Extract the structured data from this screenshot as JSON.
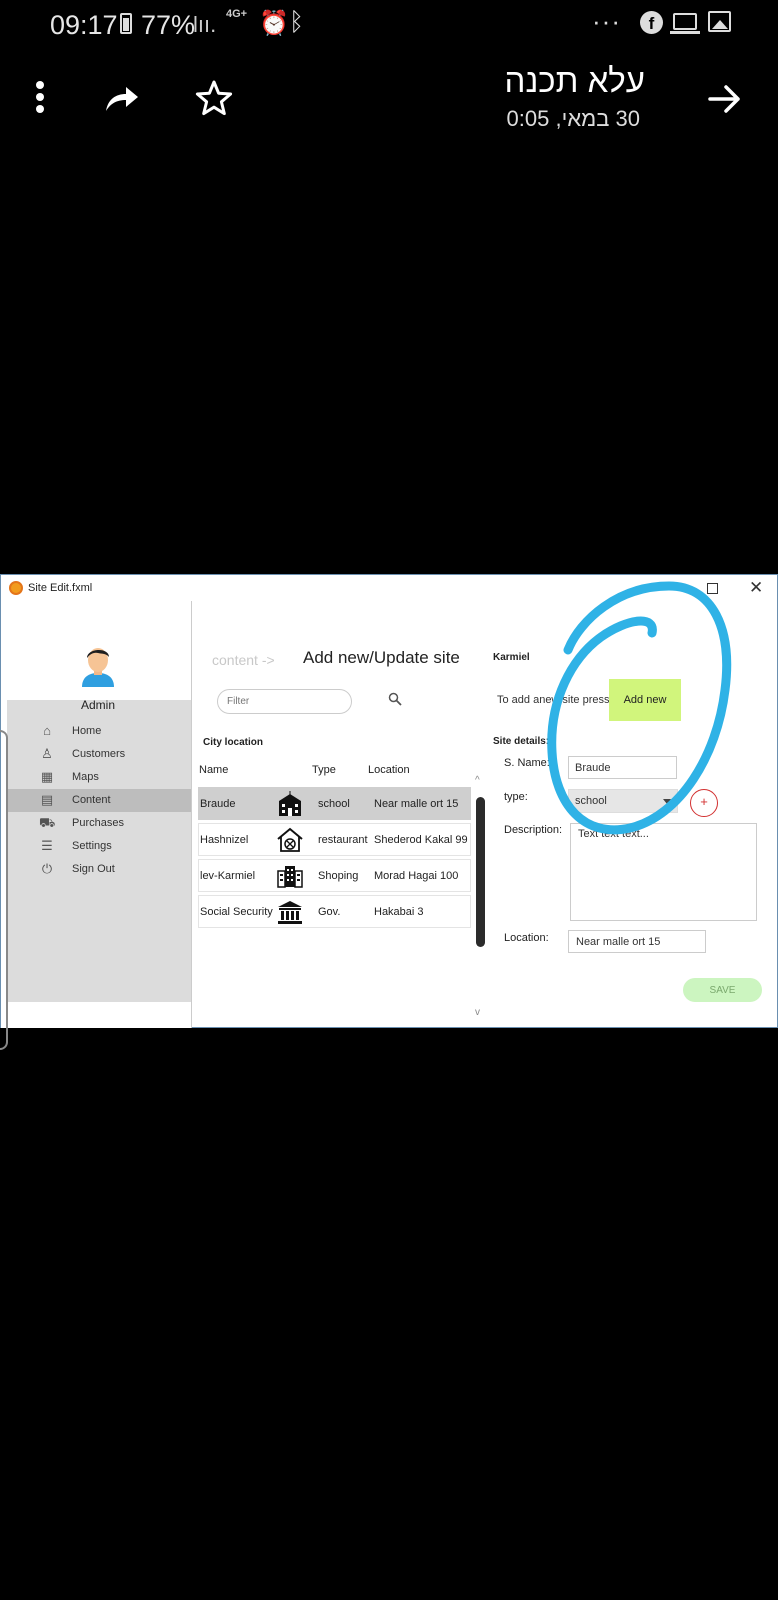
{
  "status_bar": {
    "time": "09:17",
    "battery": "77%",
    "signal": "lıı.",
    "network": "4G+",
    "overflow_dots": "···",
    "facebook_letter": "f"
  },
  "app_bar": {
    "title": "עלא תכנה",
    "subtitle": "30 במאי, 0:05"
  },
  "window": {
    "title": "Site Edit.fxml",
    "max_symbol": "",
    "close_symbol": "✕"
  },
  "sidebar": {
    "user": "Admin",
    "items": [
      {
        "label": "Home",
        "icon": "⌂"
      },
      {
        "label": "Customers",
        "icon": "♙"
      },
      {
        "label": "Maps",
        "icon": "▦"
      },
      {
        "label": "Content",
        "icon": "▤"
      },
      {
        "label": "Purchases",
        "icon": "⛟"
      },
      {
        "label": "Settings",
        "icon": "☰"
      },
      {
        "label": "Sign Out",
        "icon": "⏻"
      }
    ],
    "active_item": "Content"
  },
  "main": {
    "breadcrumb": "content ->",
    "title": "Add new/Update site",
    "filter_placeholder": "Filter",
    "city_location": "City location",
    "columns": [
      "Name",
      "Type",
      "Location"
    ],
    "rows": [
      {
        "name": "Braude",
        "type": "school",
        "location": "Near malle ort 15",
        "icon": "school-icon"
      },
      {
        "name": "Hashnizel",
        "type": "restaurant",
        "location": "Shederod Kakal 99",
        "icon": "restaurant-icon"
      },
      {
        "name": "lev-Karmiel",
        "type": "Shoping",
        "location": "Morad Hagai 100",
        "icon": "mall-icon"
      },
      {
        "name": "Social Security",
        "type": "Gov.",
        "location": "Hakabai 3",
        "icon": "government-icon"
      }
    ],
    "scroll_up": "^",
    "scroll_down": "v"
  },
  "details": {
    "city": "Karmiel",
    "hint": "To add anew site press",
    "add_new": "Add new",
    "section": "Site details:",
    "name_label": "S. Name:",
    "name_value": "Braude",
    "type_label": "type:",
    "type_value": "school",
    "add_type": "+",
    "description_label": "Description:",
    "description_value": "Text text text...",
    "location_label": "Location:",
    "location_value": "Near malle ort 15",
    "save": "SAVE"
  },
  "colors": {
    "highlight_green": "#d1f57c",
    "save_green": "#ccf5c0",
    "scribble_blue": "#2fb2e6"
  }
}
